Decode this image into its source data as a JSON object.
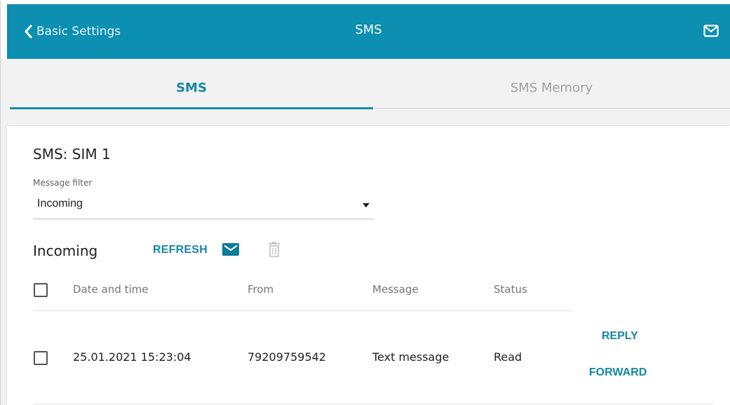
{
  "header": {
    "back_label": "Basic Settings",
    "title": "SMS",
    "back_icon": "chevron-left-icon",
    "mail_icon": "mail-icon",
    "color": "#0c8fb0"
  },
  "tabs": [
    {
      "label": "SMS",
      "active": true
    },
    {
      "label": "SMS Memory",
      "active": false
    }
  ],
  "accent_color": "#1687a7",
  "section": {
    "title": "SMS: SIM 1",
    "filter": {
      "label": "Message filter",
      "value": "Incoming"
    }
  },
  "list": {
    "title": "Incoming",
    "refresh_label": "REFRESH",
    "new_sms_icon": "mail-icon",
    "delete_icon": "trash-icon",
    "columns": [
      "Date and time",
      "From",
      "Message",
      "Status"
    ],
    "rows": [
      {
        "date": "25.01.2021 15:23:04",
        "from": "79209759542",
        "message": "Text message",
        "status": "Read",
        "actions": [
          "REPLY",
          "FORWARD"
        ]
      }
    ]
  }
}
